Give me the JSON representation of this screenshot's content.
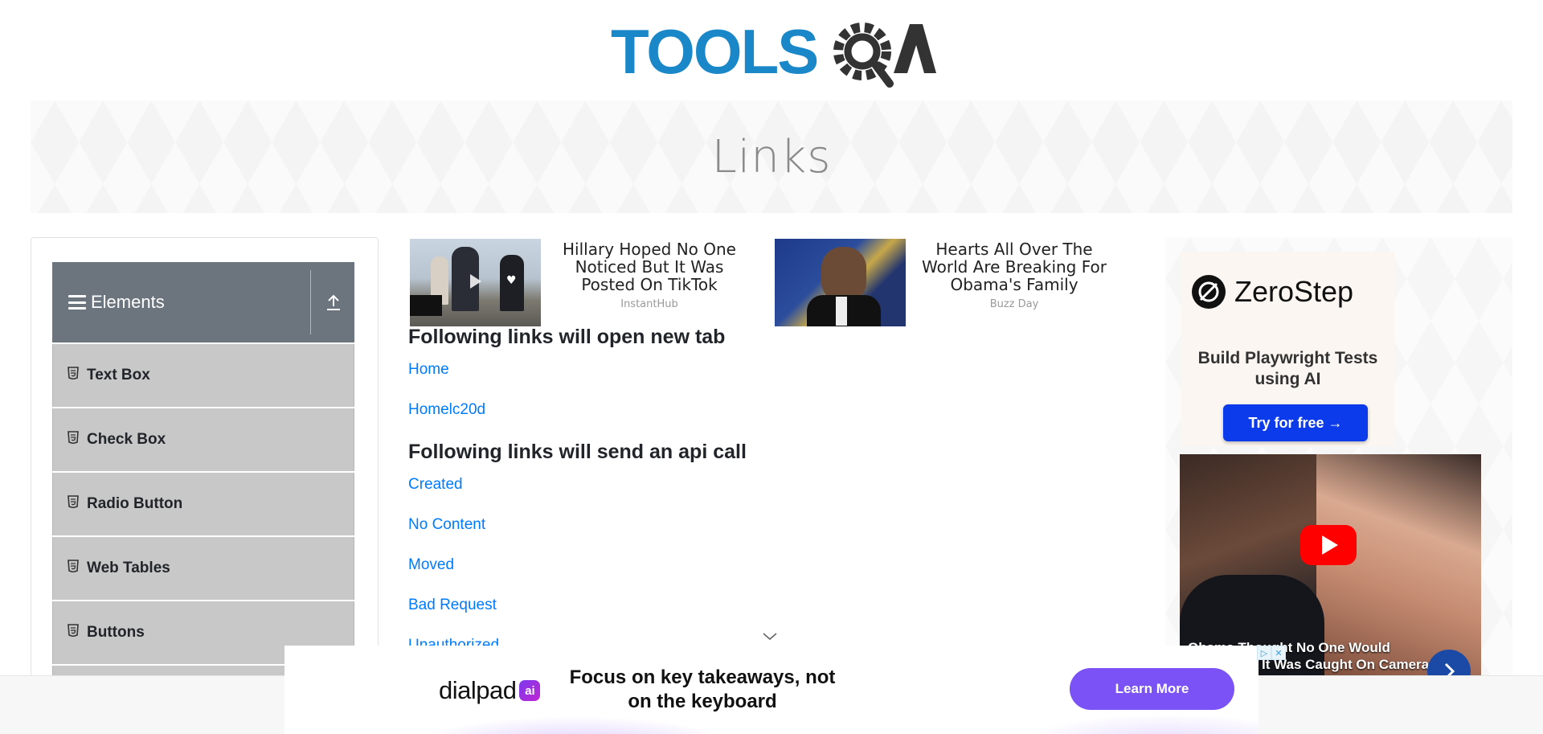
{
  "header": {
    "logo_text": "TOOLSQA"
  },
  "banner": {
    "title": "Links"
  },
  "sidebar": {
    "group_title": "Elements",
    "items": [
      {
        "label": "Text Box"
      },
      {
        "label": "Check Box"
      },
      {
        "label": "Radio Button"
      },
      {
        "label": "Web Tables"
      },
      {
        "label": "Buttons"
      }
    ]
  },
  "ads_top": [
    {
      "title": "Hillary Hoped No One Noticed But It Was Posted On TikTok",
      "source": "InstantHub"
    },
    {
      "title": "Hearts All Over The World Are Breaking For Obama's Family",
      "source": "Buzz Day"
    }
  ],
  "main": {
    "section_new_tab": {
      "heading": "Following links will open new tab",
      "links": [
        "Home",
        "Homelc20d"
      ]
    },
    "section_api": {
      "heading": "Following links will send an api call",
      "links": [
        "Created",
        "No Content",
        "Moved",
        "Bad Request",
        "Unauthorized"
      ]
    }
  },
  "right_ad": {
    "brand": "ZeroStep",
    "tagline": "Build Playwright Tests using AI",
    "cta": "Try for free →",
    "video_caption_line1": "Obama Thought No One Would",
    "video_caption_line2": "It Was Caught On Camera"
  },
  "bottom_ad": {
    "brand": "dialpad",
    "badge": "ai",
    "headline": "Focus on key takeaways, not on the keyboard",
    "cta": "Learn More"
  },
  "colors": {
    "link": "#007bff",
    "sidebar_header": "#6c757d",
    "menu_item_bg": "#c8c8c8",
    "cta_blue": "#0b3bea",
    "learn_more": "#7b52f5"
  }
}
